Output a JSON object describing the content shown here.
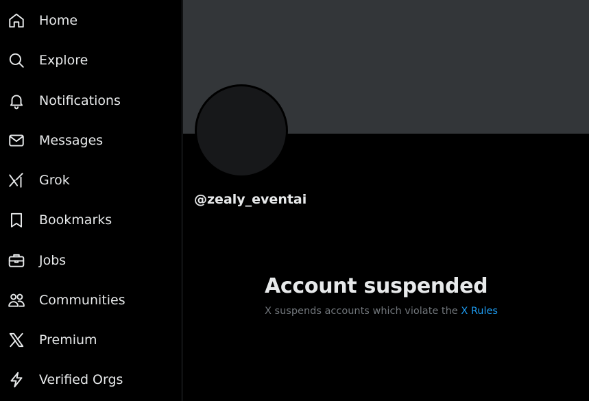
{
  "sidebar": {
    "items": [
      {
        "label": "Home",
        "icon": "home-icon"
      },
      {
        "label": "Explore",
        "icon": "search-icon"
      },
      {
        "label": "Notifications",
        "icon": "bell-icon"
      },
      {
        "label": "Messages",
        "icon": "envelope-icon"
      },
      {
        "label": "Grok",
        "icon": "grok-icon"
      },
      {
        "label": "Bookmarks",
        "icon": "bookmark-icon"
      },
      {
        "label": "Jobs",
        "icon": "briefcase-icon"
      },
      {
        "label": "Communities",
        "icon": "people-icon"
      },
      {
        "label": "Premium",
        "icon": "x-logo-icon"
      },
      {
        "label": "Verified Orgs",
        "icon": "lightning-icon"
      }
    ]
  },
  "profile": {
    "handle": "@zealy_eventai"
  },
  "suspension": {
    "title": "Account suspended",
    "message": "X suspends accounts which violate the",
    "rules_link": "X Rules"
  },
  "colors": {
    "background": "#000000",
    "banner": "#333639",
    "text": "#e7e9ea",
    "muted": "#71767b",
    "link": "#1d9bf0"
  }
}
